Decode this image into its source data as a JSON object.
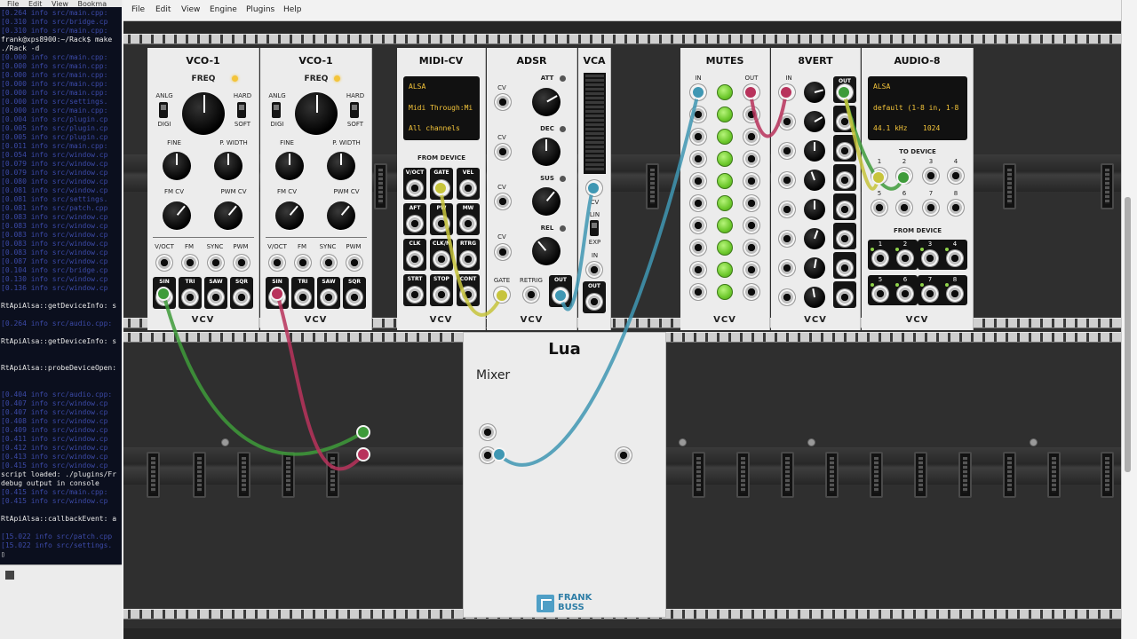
{
  "terminal": {
    "menu": [
      "File",
      "Edit",
      "View",
      "Bookma"
    ],
    "lines": [
      {
        "text": "[0.264 info src/main.cpp:",
        "kind": "blue"
      },
      {
        "text": "[0.310 info src/bridge.cp",
        "kind": "blue"
      },
      {
        "text": "[0.310 info src/main.cpp:",
        "kind": "blue"
      },
      {
        "text": "frank@xps8900:~/Rack$ make",
        "kind": "white"
      },
      {
        "text": "./Rack -d",
        "kind": "white"
      },
      {
        "text": "[0.000 info src/main.cpp:",
        "kind": "blue"
      },
      {
        "text": "[0.000 info src/main.cpp:",
        "kind": "blue"
      },
      {
        "text": "[0.000 info src/main.cpp:",
        "kind": "blue"
      },
      {
        "text": "[0.000 info src/main.cpp:",
        "kind": "blue"
      },
      {
        "text": "[0.000 info src/main.cpp:",
        "kind": "blue"
      },
      {
        "text": "[0.000 info src/settings.",
        "kind": "blue"
      },
      {
        "text": "[0.000 info src/main.cpp:",
        "kind": "blue"
      },
      {
        "text": "[0.004 info src/plugin.cp",
        "kind": "blue"
      },
      {
        "text": "[0.005 info src/plugin.cp",
        "kind": "blue"
      },
      {
        "text": "[0.005 info src/plugin.cp",
        "kind": "blue"
      },
      {
        "text": "[0.011 info src/main.cpp:",
        "kind": "blue"
      },
      {
        "text": "[0.054 info src/window.cp",
        "kind": "blue"
      },
      {
        "text": "[0.079 info src/window.cp",
        "kind": "blue"
      },
      {
        "text": "[0.079 info src/window.cp",
        "kind": "blue"
      },
      {
        "text": "[0.080 info src/window.cp",
        "kind": "blue"
      },
      {
        "text": "[0.081 info src/window.cp",
        "kind": "blue"
      },
      {
        "text": "[0.081 info src/settings.",
        "kind": "blue"
      },
      {
        "text": "[0.081 info src/patch.cpp",
        "kind": "blue"
      },
      {
        "text": "[0.083 info src/window.cp",
        "kind": "blue"
      },
      {
        "text": "[0.083 info src/window.cp",
        "kind": "blue"
      },
      {
        "text": "[0.083 info src/window.cp",
        "kind": "blue"
      },
      {
        "text": "[0.083 info src/window.cp",
        "kind": "blue"
      },
      {
        "text": "[0.083 info src/window.cp",
        "kind": "blue"
      },
      {
        "text": "[0.087 info src/window.cp",
        "kind": "blue"
      },
      {
        "text": "[0.104 info src/bridge.cp",
        "kind": "blue"
      },
      {
        "text": "[0.130 info src/window.cp",
        "kind": "blue"
      },
      {
        "text": "[0.136 info src/window.cp",
        "kind": "blue"
      },
      {
        "text": "",
        "kind": "white"
      },
      {
        "text": "RtApiAlsa::getDeviceInfo: s",
        "kind": "white"
      },
      {
        "text": "",
        "kind": "white"
      },
      {
        "text": "[0.264 info src/audio.cpp:",
        "kind": "blue"
      },
      {
        "text": "",
        "kind": "white"
      },
      {
        "text": "RtApiAlsa::getDeviceInfo: s",
        "kind": "white"
      },
      {
        "text": "",
        "kind": "white"
      },
      {
        "text": "",
        "kind": "white"
      },
      {
        "text": "RtApiAlsa::probeDeviceOpen:",
        "kind": "white"
      },
      {
        "text": "",
        "kind": "white"
      },
      {
        "text": "",
        "kind": "white"
      },
      {
        "text": "[0.404 info src/audio.cpp:",
        "kind": "blue"
      },
      {
        "text": "[0.407 info src/window.cp",
        "kind": "blue"
      },
      {
        "text": "[0.407 info src/window.cp",
        "kind": "blue"
      },
      {
        "text": "[0.408 info src/window.cp",
        "kind": "blue"
      },
      {
        "text": "[0.409 info src/window.cp",
        "kind": "blue"
      },
      {
        "text": "[0.411 info src/window.cp",
        "kind": "blue"
      },
      {
        "text": "[0.412 info src/window.cp",
        "kind": "blue"
      },
      {
        "text": "[0.413 info src/window.cp",
        "kind": "blue"
      },
      {
        "text": "[0.415 info src/window.cp",
        "kind": "blue"
      },
      {
        "text": "script loaded: ./plugins/Fr",
        "kind": "white"
      },
      {
        "text": "debug output in console",
        "kind": "white"
      },
      {
        "text": "[0.415 info src/main.cpp:",
        "kind": "blue"
      },
      {
        "text": "[0.415 info src/window.cp",
        "kind": "blue"
      },
      {
        "text": "",
        "kind": "white"
      },
      {
        "text": "RtApiAlsa::callbackEvent: a",
        "kind": "white"
      },
      {
        "text": "",
        "kind": "white"
      },
      {
        "text": "[15.022 info src/patch.cpp",
        "kind": "blue"
      },
      {
        "text": "[15.022 info src/settings.",
        "kind": "blue"
      },
      {
        "text": "▯",
        "kind": "white"
      }
    ]
  },
  "menubar": {
    "items": [
      "File",
      "Edit",
      "View",
      "Engine",
      "Plugins",
      "Help"
    ]
  },
  "modules": {
    "vco1": {
      "title": "VCO-1",
      "freq": "FREQ",
      "anlg": "ANLG",
      "digi": "DIGI",
      "hard": "HARD",
      "soft": "SOFT",
      "fine": "FINE",
      "pwidth": "P. WIDTH",
      "fmcv": "FM CV",
      "pwmcv": "PWM CV",
      "voct": "V/OCT",
      "fm": "FM",
      "sync": "SYNC",
      "pwm": "PWM",
      "sin": "SIN",
      "tri": "TRI",
      "saw": "SAW",
      "sqr": "SQR",
      "logo": "VCV"
    },
    "vco2": {
      "title": "VCO-1",
      "freq": "FREQ",
      "anlg": "ANLG",
      "digi": "DIGI",
      "hard": "HARD",
      "soft": "SOFT",
      "fine": "FINE",
      "pwidth": "P. WIDTH",
      "fmcv": "FM CV",
      "pwmcv": "PWM CV",
      "voct": "V/OCT",
      "fm": "FM",
      "sync": "SYNC",
      "pwm": "PWM",
      "sin": "SIN",
      "tri": "TRI",
      "saw": "SAW",
      "sqr": "SQR",
      "logo": "VCV"
    },
    "midicv": {
      "title": "MIDI-CV",
      "screen": [
        "ALSA",
        "Midi Through:Mi",
        "All channels"
      ],
      "from_device": "FROM DEVICE",
      "jacks": [
        "V/OCT",
        "GATE",
        "VEL",
        "AFT",
        "PW",
        "MW",
        "CLK",
        "CLK/N",
        "RTRG",
        "STRT",
        "STOP",
        "CONT"
      ],
      "logo": "VCV"
    },
    "adsr": {
      "title": "ADSR",
      "att": "ATT",
      "dec": "DEC",
      "sus": "SUS",
      "rel": "REL",
      "cv": "CV",
      "gate": "GATE",
      "retrig": "RETRIG",
      "out": "OUT",
      "logo": "VCV"
    },
    "vca": {
      "title": "VCA",
      "cv": "CV",
      "lin": "LIN",
      "exp": "EXP",
      "in": "IN",
      "out": "OUT"
    },
    "mutes": {
      "title": "MUTES",
      "in": "IN",
      "out": "OUT",
      "logo": "VCV"
    },
    "eightvert": {
      "title": "8VERT",
      "in": "IN",
      "out": "OUT",
      "logo": "VCV"
    },
    "audio8": {
      "title": "AUDIO-8",
      "screen_driver": "ALSA",
      "screen_device": "default (1-8 in, 1-8",
      "screen_rate": "44.1 kHz",
      "screen_block": "1024",
      "to_device": "TO DEVICE",
      "from_device": "FROM DEVICE",
      "to_numbers": [
        "1",
        "2",
        "3",
        "4",
        "5",
        "6",
        "7",
        "8"
      ],
      "from_numbers": [
        "1",
        "2",
        "3",
        "4",
        "5",
        "6",
        "7",
        "8"
      ],
      "logo": "VCV"
    },
    "lua": {
      "title": "Lua",
      "script": "Mixer",
      "logo_line1": "FRANK",
      "logo_line2": "BUSS"
    }
  },
  "colors": {
    "cable_green": "#3e9b3a",
    "cable_red": "#b8335c",
    "cable_blue": "#3f97b3",
    "cable_yellow": "#c7c43c",
    "led": "#f3c43a"
  }
}
